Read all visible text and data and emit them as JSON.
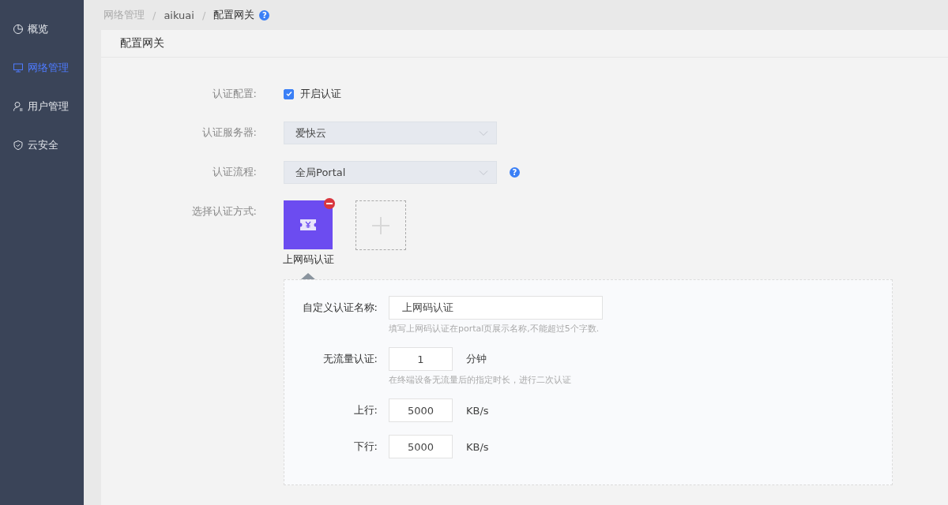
{
  "sidebar": {
    "items": [
      {
        "label": "概览",
        "selected": false
      },
      {
        "label": "网络管理",
        "selected": true
      },
      {
        "label": "用户管理",
        "selected": false
      },
      {
        "label": "云安全",
        "selected": false
      }
    ]
  },
  "breadcrumb": {
    "items": [
      "网络管理",
      "aikuai",
      "配置网关"
    ],
    "separator": "/",
    "help": "?"
  },
  "page_title": "配置网关",
  "form": {
    "auth_config": {
      "label": "认证配置:",
      "checkbox_label": "开启认证",
      "checked": true
    },
    "auth_server": {
      "label": "认证服务器:",
      "value": "爱快云"
    },
    "auth_flow": {
      "label": "认证流程:",
      "value": "全局Portal",
      "help": "?"
    },
    "auth_methods": {
      "label": "选择认证方式:",
      "methods": [
        {
          "name": "上网码认证",
          "selected": true
        }
      ]
    },
    "method_panel": {
      "fields": [
        {
          "label": "自定义认证名称:",
          "value": "上网码认证",
          "hint": "填写上网码认证在portal页展示名称,不能超过5个字数."
        },
        {
          "label": "无流量认证:",
          "value": "1",
          "unit": "分钟",
          "hint": "在终端设备无流量后的指定时长，进行二次认证"
        },
        {
          "label": "上行:",
          "value": "5000",
          "unit": "KB/s"
        },
        {
          "label": "下行:",
          "value": "5000",
          "unit": "KB/s"
        }
      ]
    }
  }
}
